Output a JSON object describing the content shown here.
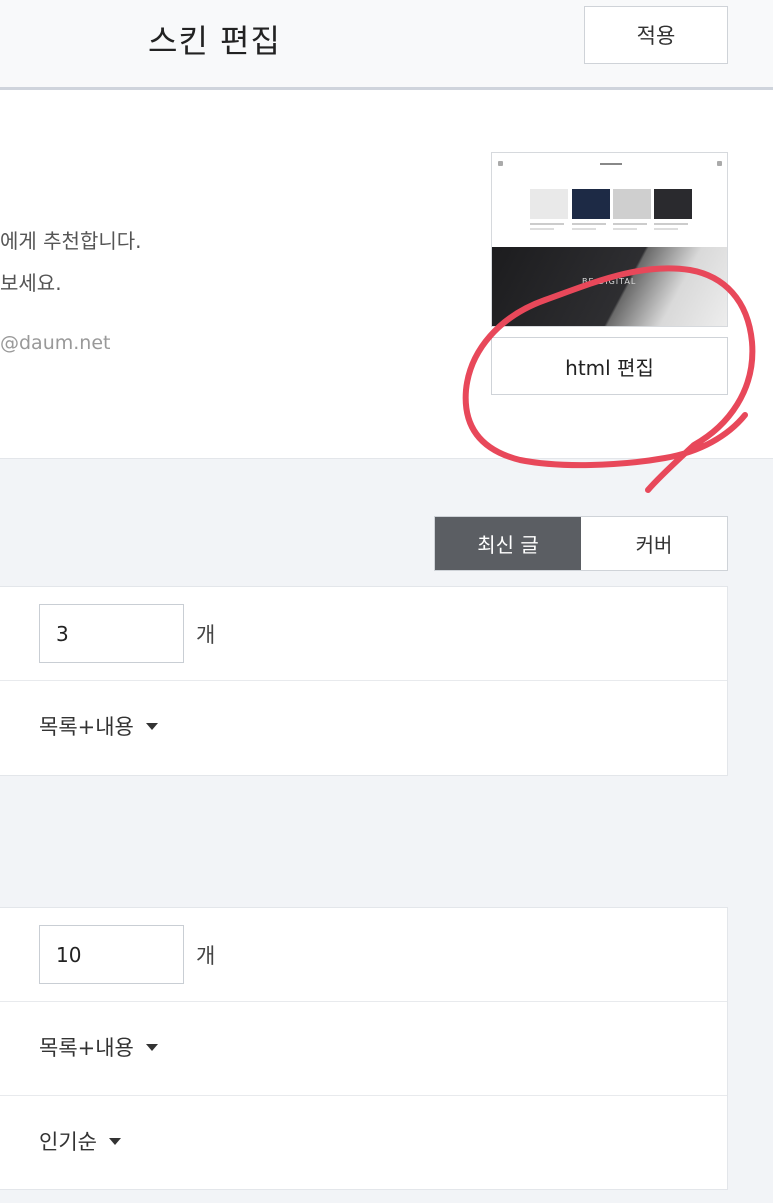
{
  "header": {
    "title": "스킨 편집",
    "apply_label": "적용"
  },
  "info": {
    "desc_line1": "에게 추천합니다.",
    "desc_line2": "보세요.",
    "email": "@daum.net",
    "thumbnail_hero_text": "BE DIGITAL",
    "html_edit_label": "html 편집"
  },
  "annotation": {
    "color": "#e8485a"
  },
  "tabs": [
    {
      "label": "최신 글",
      "active": true
    },
    {
      "label": "커버",
      "active": false
    }
  ],
  "section1": {
    "count_value": "3",
    "count_unit": "개",
    "display_select": "목록+내용"
  },
  "section2": {
    "count_value": "10",
    "count_unit": "개",
    "display_select": "목록+내용",
    "sort_select": "인기순"
  }
}
